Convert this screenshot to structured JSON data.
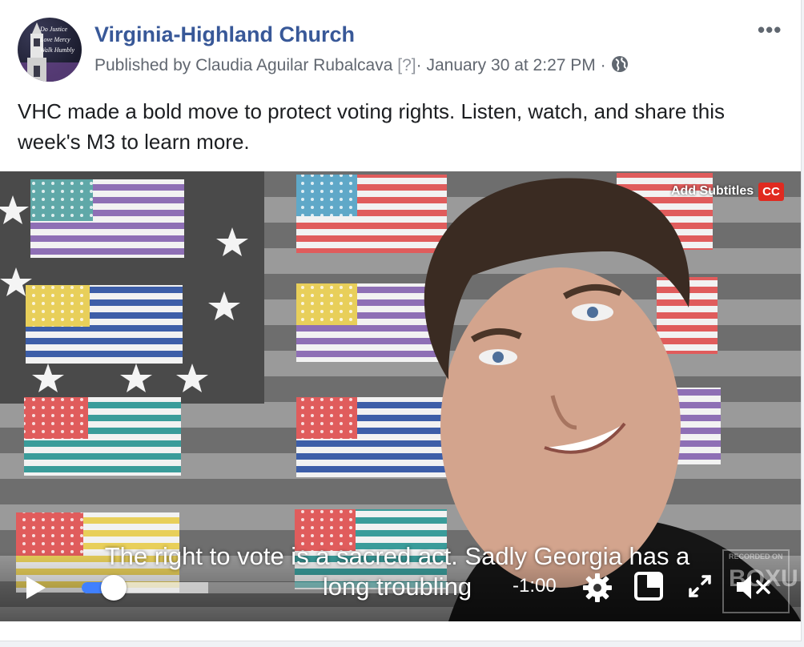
{
  "header": {
    "avatar_motto": "Do Justice\nLove Mercy\nWalk Humbly",
    "page_name": "Virginia-Highland Church",
    "published_prefix": "Published by",
    "author": "Claudia Aguilar Rubalcava",
    "help_marker": "[?]",
    "separator": "·",
    "timestamp": "January 30 at 2:27 PM",
    "privacy_icon": "globe-icon",
    "more_icon": "more-options-icon",
    "more_label": "•••"
  },
  "post": {
    "text": "VHC made a bold move to protect voting rights. Listen, watch, and share this week's M3 to learn more."
  },
  "video": {
    "add_subtitles_label": "Add Subtitles",
    "cc_label": "CC",
    "caption_line1": "The right to vote is a sacred act. Sadly Georgia has a",
    "caption_line2": "long troubling",
    "time_remaining": "-1:00",
    "played_fraction": 0.07,
    "buffered_fraction": 0.33,
    "controls": {
      "play_icon": "play-icon",
      "settings_icon": "gear-icon",
      "pip_icon": "picture-in-picture-icon",
      "fullscreen_icon": "fullscreen-icon",
      "mute_icon": "muted-speaker-icon"
    },
    "watermark_line1": "RECORDED ON",
    "watermark_line2": "BOXU"
  },
  "colors": {
    "link_blue": "#385898",
    "progress_blue": "#4080ff",
    "cc_red": "#e02a20",
    "meta_gray": "#616770"
  }
}
